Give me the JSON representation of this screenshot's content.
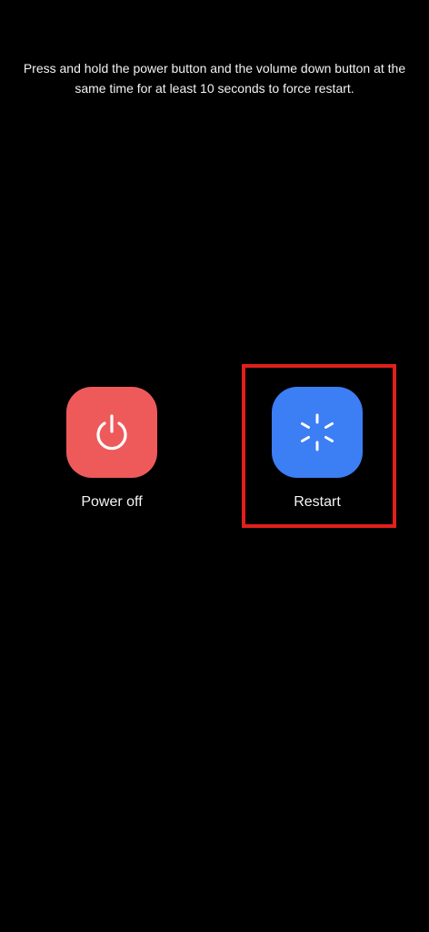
{
  "hint_text": "Press and hold the power button and the volume down button at the same time for at least 10 seconds to force restart.",
  "actions": {
    "power_off": {
      "label": "Power off",
      "icon": "power-icon",
      "color": "#ee5a5a"
    },
    "restart": {
      "label": "Restart",
      "icon": "restart-spinner-icon",
      "color": "#3c7ef3"
    }
  },
  "highlight_color": "#e0201c"
}
